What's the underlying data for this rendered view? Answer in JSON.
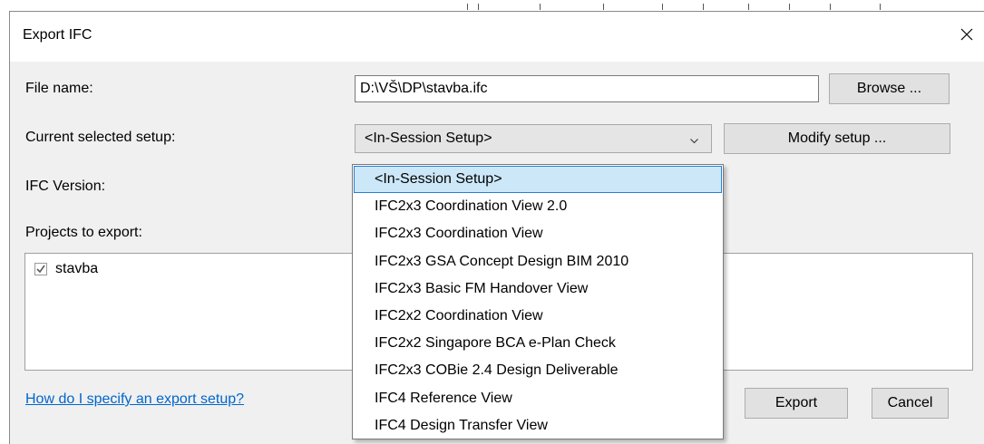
{
  "dialog": {
    "title": "Export IFC",
    "close_icon": "close-icon"
  },
  "file_name": {
    "label": "File name:",
    "value": "D:\\VŠ\\DP\\stavba.ifc",
    "browse_label": "Browse ..."
  },
  "setup": {
    "label": "Current selected setup:",
    "selected": "<In-Session Setup>",
    "modify_label": "Modify setup ...",
    "options": [
      "<In-Session Setup>",
      "IFC2x3 Coordination View 2.0",
      "IFC2x3 Coordination View",
      "IFC2x3 GSA Concept Design BIM 2010",
      "IFC2x3 Basic FM Handover View",
      "IFC2x2 Coordination View",
      "IFC2x2 Singapore BCA e-Plan Check",
      "IFC2x3 COBie 2.4 Design Deliverable",
      "IFC4 Reference View",
      "IFC4 Design Transfer View"
    ],
    "highlighted_index": 0
  },
  "ifc_version": {
    "label": "IFC Version:"
  },
  "projects": {
    "label": "Projects to export:",
    "items": [
      {
        "label": "stavba",
        "checked": true
      }
    ]
  },
  "help_link": "How do I specify an export setup?",
  "footer": {
    "export_label": "Export",
    "cancel_label": "Cancel"
  },
  "colors": {
    "dialog_bg": "#f0f0f0",
    "highlight_bg": "#cce8f8",
    "highlight_border": "#2a7fd4",
    "link": "#0066cc"
  }
}
